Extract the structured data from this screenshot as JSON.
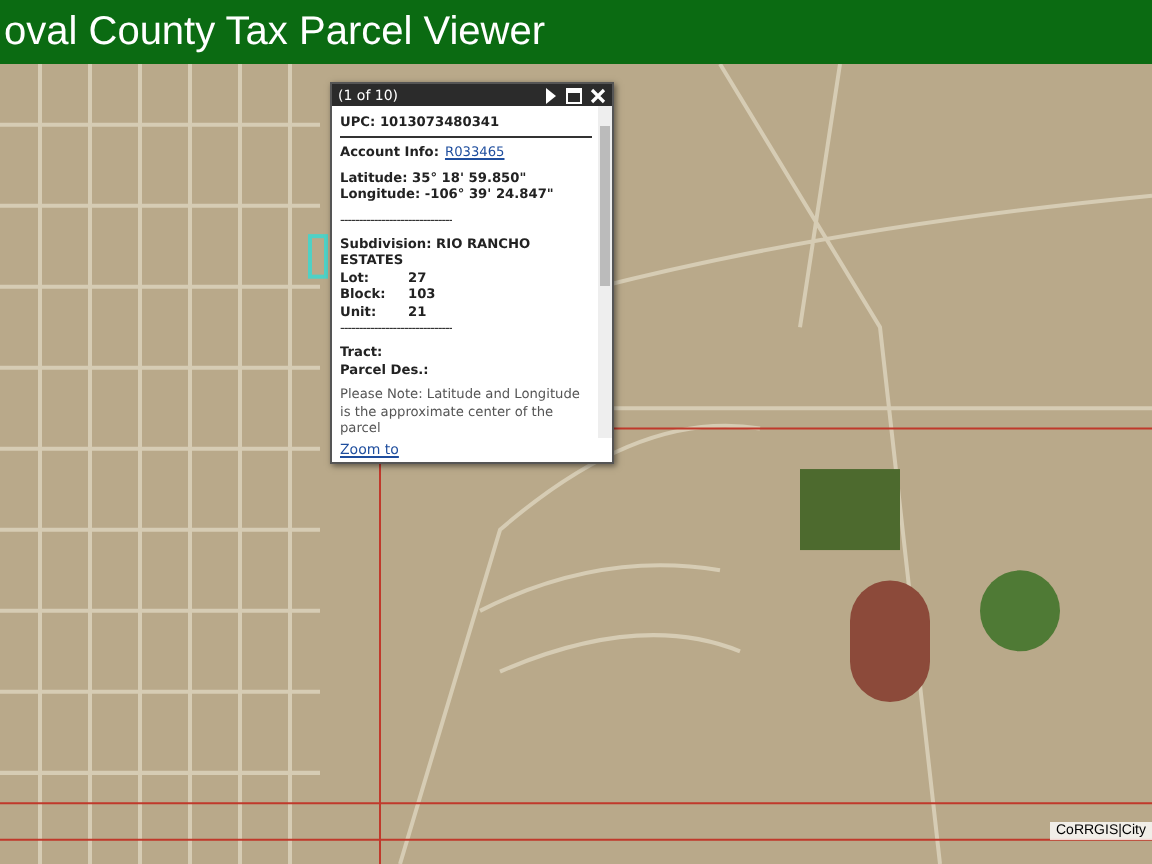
{
  "header": {
    "title": "oval County Tax Parcel Viewer"
  },
  "popup": {
    "counter": "(1 of 10)",
    "upc": "UPC: 1013073480341",
    "account_label": "Account Info:",
    "account_link": "R033465",
    "latitude": "Latitude: 35° 18' 59.850\"",
    "longitude": "Longitude: -106° 39' 24.847\"",
    "separator": "------------------------------",
    "subdivision": "Subdivision: RIO RANCHO ESTATES",
    "fields": [
      {
        "label": "Lot:",
        "value": "27"
      },
      {
        "label": "Block:",
        "value": "103"
      },
      {
        "label": "Unit:",
        "value": "21"
      }
    ],
    "separator_2": "------------------------------",
    "tract": "Tract:",
    "parcel_des": "Parcel Des.:",
    "note": "Please Note: Latitude and Longitude is the approximate center of the parcel",
    "zoom_link": "Zoom to"
  },
  "attribution": "CoRRGIS|City"
}
